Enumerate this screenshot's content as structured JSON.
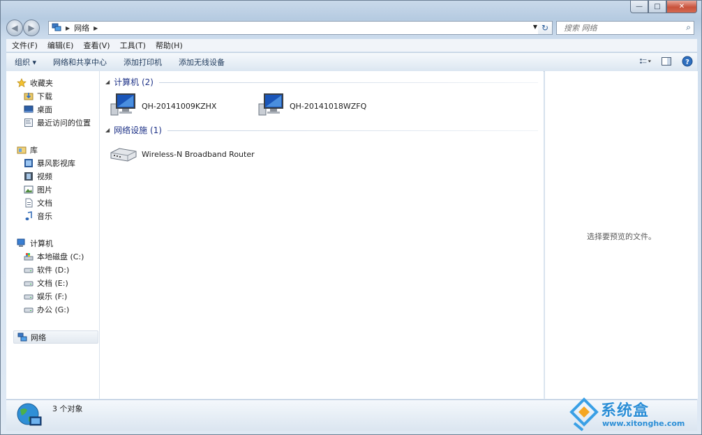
{
  "window": {
    "caption": {
      "minimize": "—",
      "maximize": "□",
      "close": "✕"
    }
  },
  "nav": {
    "back_icon": "◀",
    "forward_icon": "▶",
    "breadcrumb_arrow": "▶",
    "location": "网络",
    "dropdown": "▼",
    "refresh": "↻",
    "search_placeholder": "搜索 网络",
    "search_icon": "⌕"
  },
  "menubar": {
    "items": [
      "文件(F)",
      "编辑(E)",
      "查看(V)",
      "工具(T)",
      "帮助(H)"
    ]
  },
  "toolbar": {
    "organize": "组织 ▾",
    "network_center": "网络和共享中心",
    "add_printer": "添加打印机",
    "add_wireless": "添加无线设备"
  },
  "sidebar": {
    "favorites": {
      "label": "收藏夹",
      "items": [
        "下载",
        "桌面",
        "最近访问的位置"
      ]
    },
    "libraries": {
      "label": "库",
      "items": [
        "暴风影视库",
        "视频",
        "图片",
        "文档",
        "音乐"
      ]
    },
    "computer": {
      "label": "计算机",
      "items": [
        "本地磁盘 (C:)",
        "软件 (D:)",
        "文档 (E:)",
        "娱乐 (F:)",
        "办公 (G:)"
      ]
    },
    "network": {
      "label": "网络"
    }
  },
  "content": {
    "groups": [
      {
        "title": "计算机 (2)",
        "items": [
          "QH-20141009KZHX",
          "QH-20141018WZFQ"
        ]
      },
      {
        "title": "网络设施 (1)",
        "items": [
          "Wireless-N Broadband Router"
        ]
      }
    ]
  },
  "preview": {
    "message": "选择要预览的文件。"
  },
  "status": {
    "count": "3 个对象"
  },
  "watermark": {
    "brand": "系统盒",
    "url": "www.xitonghe.com"
  },
  "colors": {
    "accent": "#1e3287",
    "window_frame": "#c9d9ea",
    "close": "#c8523c"
  }
}
